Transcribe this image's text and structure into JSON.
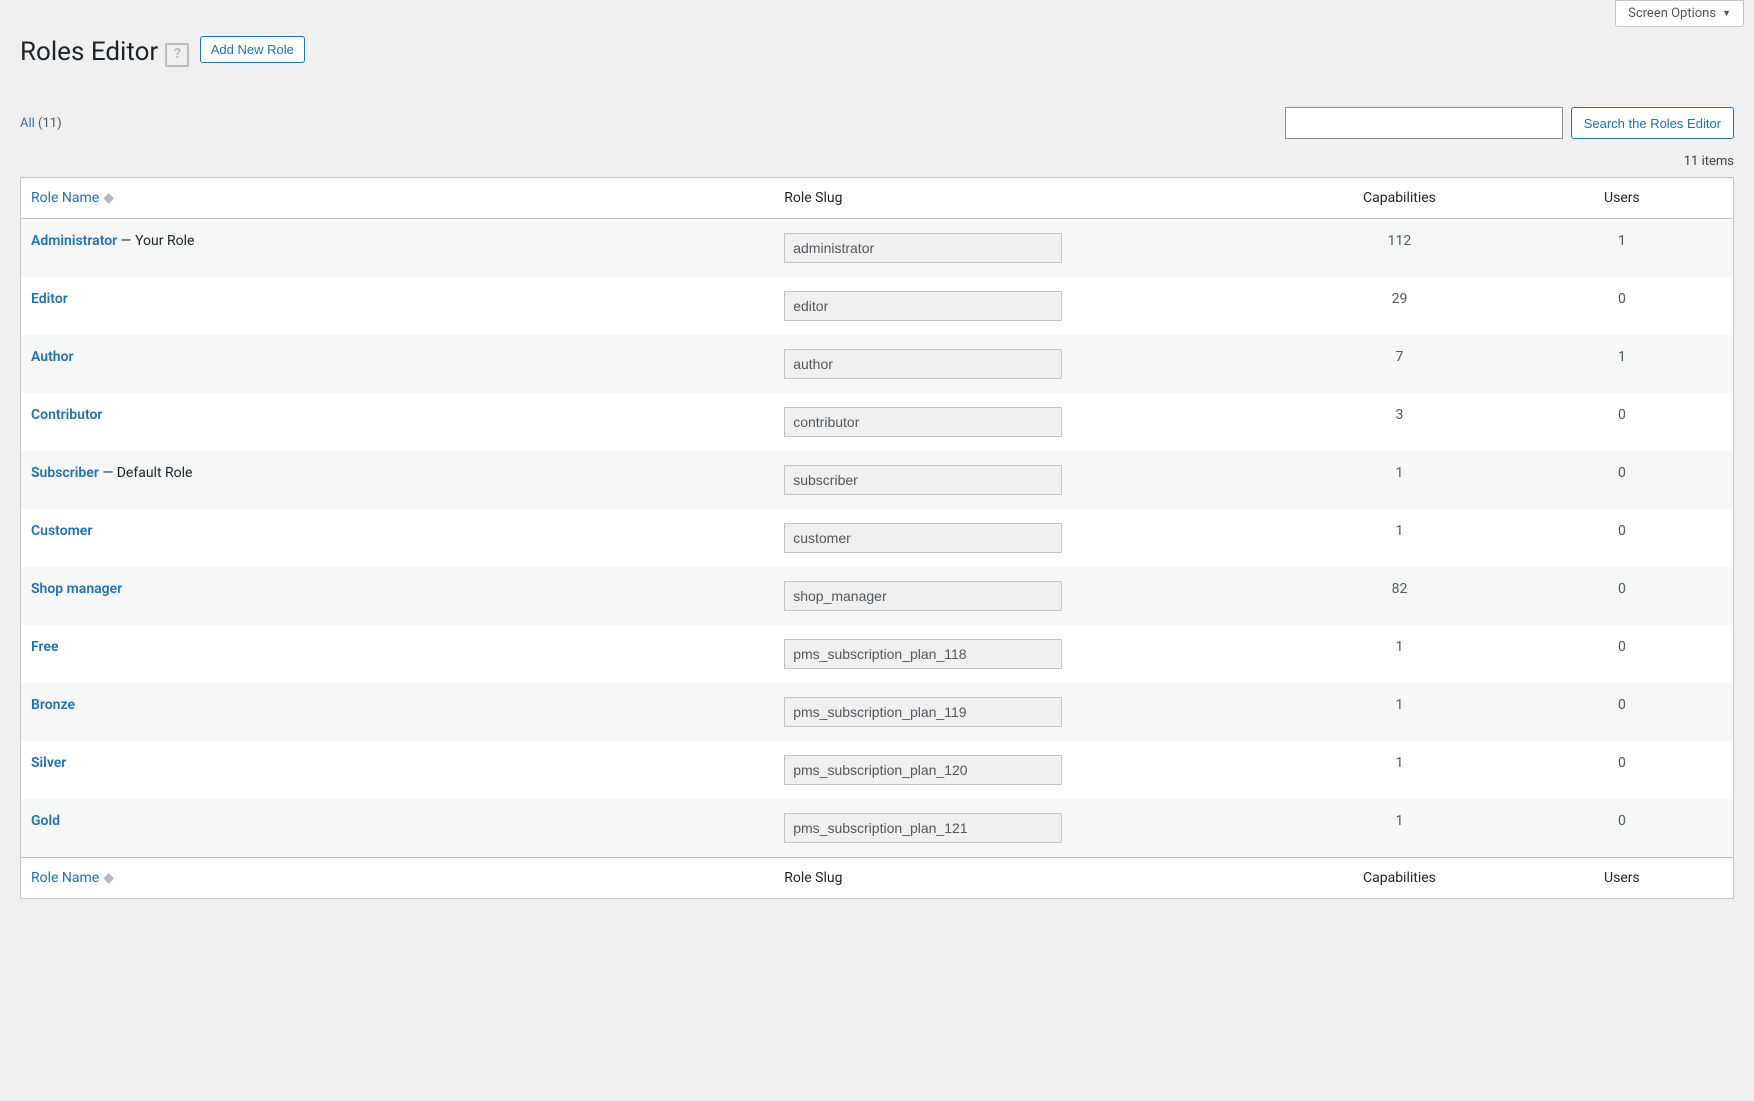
{
  "screen_options_label": "Screen Options",
  "page_title": "Roles Editor",
  "add_new_label": "Add New Role",
  "filter": {
    "all_label": "All",
    "all_count": "(11)"
  },
  "search": {
    "value": "",
    "button": "Search the Roles Editor"
  },
  "items_count_label": "11 items",
  "columns": {
    "role_name": "Role Name",
    "role_slug": "Role Slug",
    "capabilities": "Capabilities",
    "users": "Users"
  },
  "rows": [
    {
      "name": "Administrator",
      "suffix": " — Your Role",
      "slug": "administrator",
      "caps": "112",
      "users": "1"
    },
    {
      "name": "Editor",
      "suffix": "",
      "slug": "editor",
      "caps": "29",
      "users": "0"
    },
    {
      "name": "Author",
      "suffix": "",
      "slug": "author",
      "caps": "7",
      "users": "1"
    },
    {
      "name": "Contributor",
      "suffix": "",
      "slug": "contributor",
      "caps": "3",
      "users": "0"
    },
    {
      "name": "Subscriber",
      "suffix": " — Default Role",
      "slug": "subscriber",
      "caps": "1",
      "users": "0"
    },
    {
      "name": "Customer",
      "suffix": "",
      "slug": "customer",
      "caps": "1",
      "users": "0"
    },
    {
      "name": "Shop manager",
      "suffix": "",
      "slug": "shop_manager",
      "caps": "82",
      "users": "0"
    },
    {
      "name": "Free",
      "suffix": "",
      "slug": "pms_subscription_plan_118",
      "caps": "1",
      "users": "0"
    },
    {
      "name": "Bronze",
      "suffix": "",
      "slug": "pms_subscription_plan_119",
      "caps": "1",
      "users": "0"
    },
    {
      "name": "Silver",
      "suffix": "",
      "slug": "pms_subscription_plan_120",
      "caps": "1",
      "users": "0"
    },
    {
      "name": "Gold",
      "suffix": "",
      "slug": "pms_subscription_plan_121",
      "caps": "1",
      "users": "0"
    }
  ]
}
